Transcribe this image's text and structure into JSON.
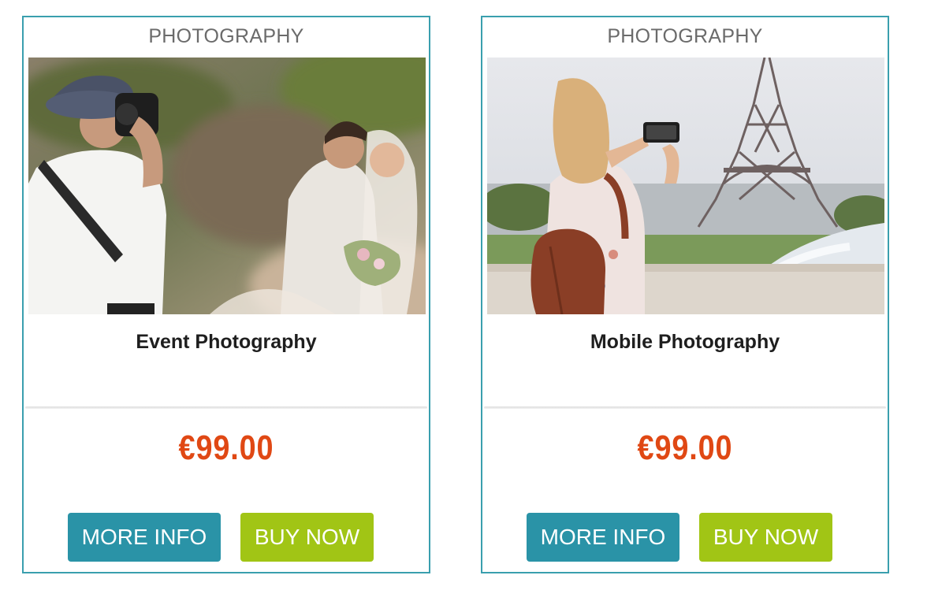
{
  "products": [
    {
      "category": "PHOTOGRAPHY",
      "image_subject": "photographer shooting wedding couple outdoors",
      "title": "Event Photography",
      "price": "€99.00",
      "more_info_label": "MORE INFO",
      "buy_now_label": "BUY NOW"
    },
    {
      "category": "PHOTOGRAPHY",
      "image_subject": "woman photographing Eiffel Tower with phone",
      "title": "Mobile Photography",
      "price": "€99.00",
      "more_info_label": "MORE INFO",
      "buy_now_label": "BUY NOW"
    }
  ],
  "colors": {
    "card_border": "#3a9fae",
    "price": "#e04814",
    "more_info_button": "#2a93a7",
    "buy_now_button": "#a1c515",
    "category_text": "#6b6b6b",
    "title_text": "#1e1e1e"
  }
}
